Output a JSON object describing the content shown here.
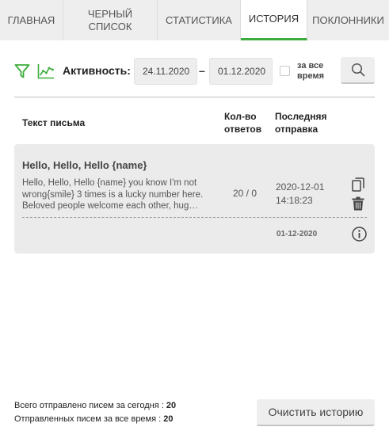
{
  "tabs": [
    {
      "label": "ГЛАВНАЯ",
      "active": false
    },
    {
      "label": "ЧЕРНЫЙ СПИСОК",
      "active": false
    },
    {
      "label": "СТАТИСТИКА",
      "active": false
    },
    {
      "label": "ИСТОРИЯ",
      "active": true
    },
    {
      "label": "ПОКЛОННИКИ",
      "active": false
    }
  ],
  "filter": {
    "activity_label": "Активность:",
    "date_from": "24.11.2020",
    "date_separator": "–",
    "date_to": "01.12.2020",
    "all_time_label": "за все время",
    "all_time_checked": false
  },
  "table": {
    "headers": {
      "text": "Текст письма",
      "count": "Кол-во ответов",
      "last_sent": "Последняя отправка"
    },
    "rows": [
      {
        "title": "Hello, Hello, Hello {name}",
        "body": "Hello, Hello, Hello {name} you know I'm not wrong{smile} 3 times is a lucky number here. Beloved people welcome each other, hug…",
        "count": "20 / 0",
        "last_sent": "2020-12-01 14:18:23",
        "date": "01-12-2020"
      }
    ]
  },
  "footer": {
    "sent_today_label": "Всего отправлено писем за сегодня :",
    "sent_today_value": "20",
    "sent_total_label": "Отправленных писем за все время :",
    "sent_total_value": "20",
    "clear_button": "Очистить историю"
  },
  "colors": {
    "accent": "#3cac3c",
    "tab_bg": "#eeeeee",
    "card_bg": "#ebebeb"
  },
  "icons": [
    "filter-icon",
    "chart-icon",
    "search-icon",
    "copy-icon",
    "trash-icon",
    "info-icon"
  ]
}
